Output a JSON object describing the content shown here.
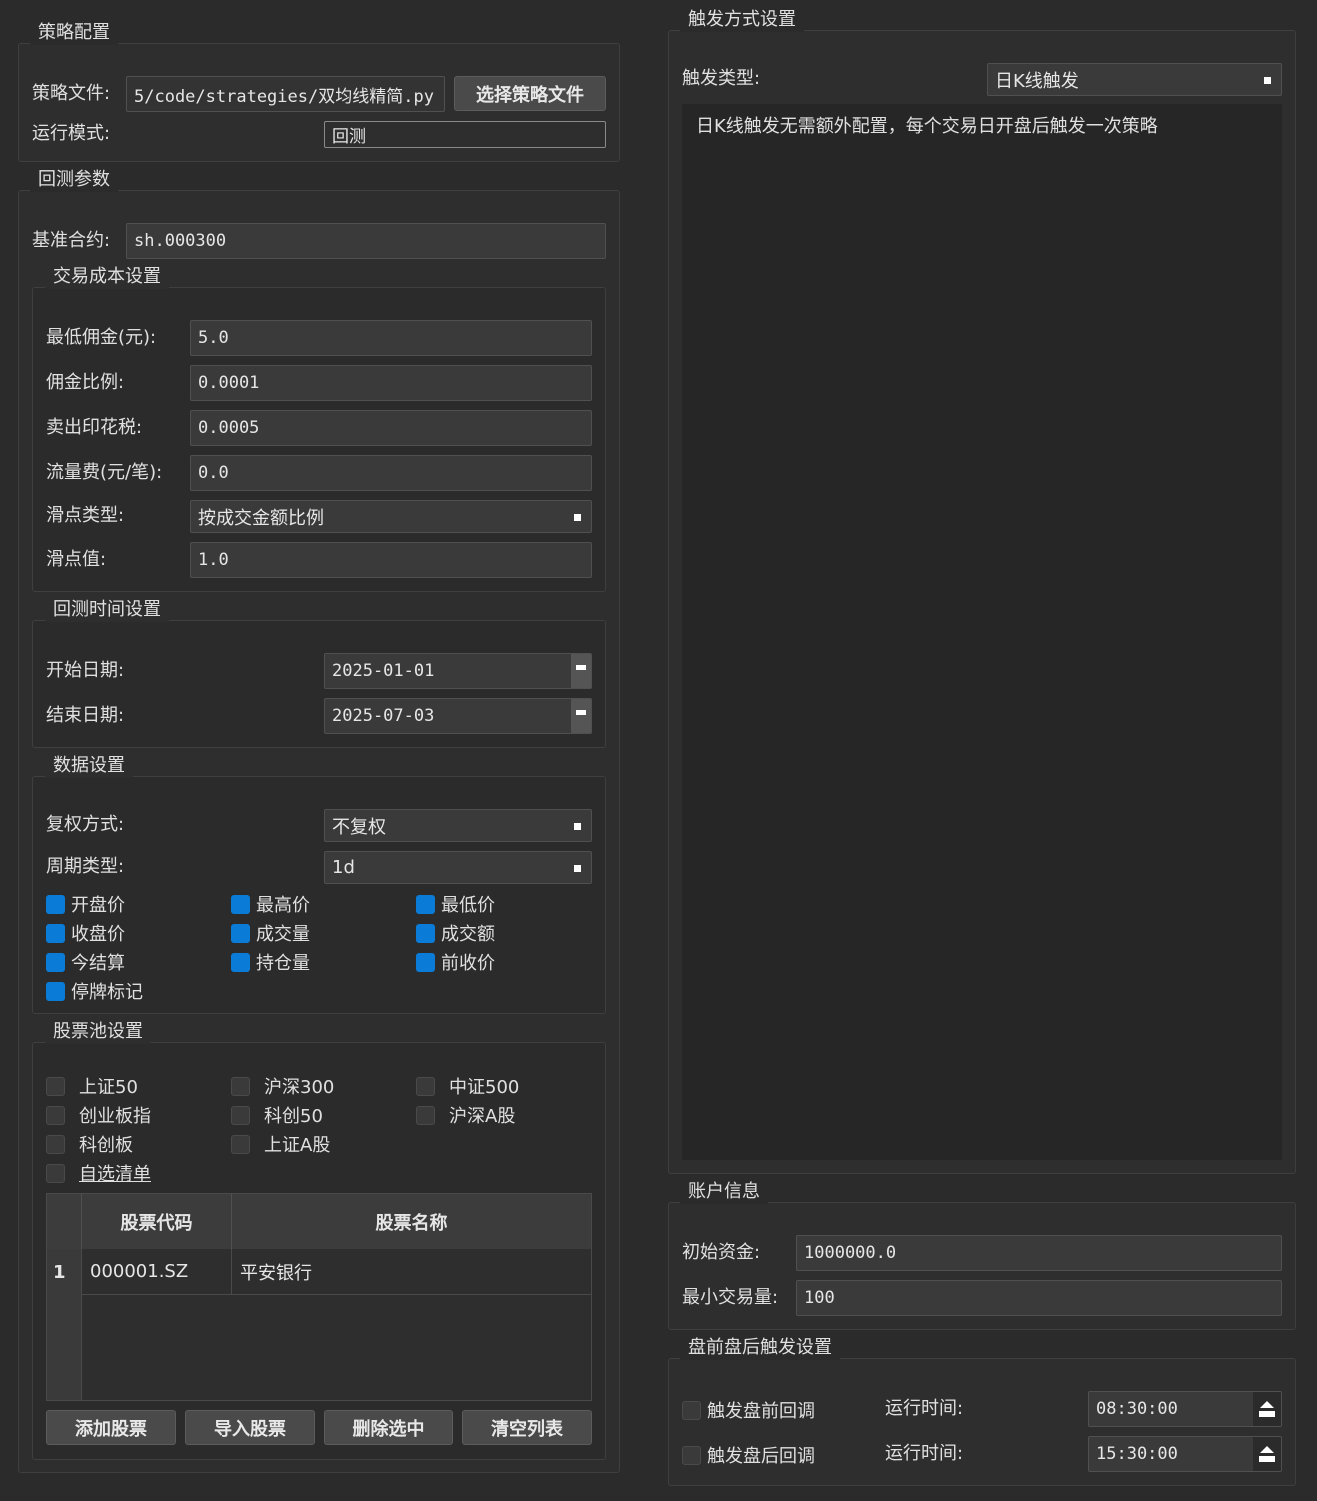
{
  "strategy": {
    "title": "策略配置",
    "file_label": "策略文件:",
    "file_value": "5/code/strategies/双均线精简.py",
    "choose_button": "选择策略文件",
    "mode_label": "运行模式:",
    "mode_value": "回测"
  },
  "backtest": {
    "title": "回测参数",
    "benchmark_label": "基准合约:",
    "benchmark_value": "sh.000300",
    "cost": {
      "title": "交易成本设置",
      "min_commission_label": "最低佣金(元):",
      "min_commission_value": "5.0",
      "commission_ratio_label": "佣金比例:",
      "commission_ratio_value": "0.0001",
      "stamp_tax_label": "卖出印花税:",
      "stamp_tax_value": "0.0005",
      "flow_fee_label": "流量费(元/笔):",
      "flow_fee_value": "0.0",
      "slippage_type_label": "滑点类型:",
      "slippage_type_value": "按成交金额比例",
      "slippage_value_label": "滑点值:",
      "slippage_value": "1.0"
    },
    "time": {
      "title": "回测时间设置",
      "start_label": "开始日期:",
      "start_value": "2025-01-01",
      "end_label": "结束日期:",
      "end_value": "2025-07-03"
    },
    "data": {
      "title": "数据设置",
      "adjust_label": "复权方式:",
      "adjust_value": "不复权",
      "period_label": "周期类型:",
      "period_value": "1d",
      "fields": [
        "开盘价",
        "最高价",
        "最低价",
        "收盘价",
        "成交量",
        "成交额",
        "今结算",
        "持仓量",
        "前收价",
        "停牌标记"
      ]
    },
    "pool": {
      "title": "股票池设置",
      "options": [
        "上证50",
        "沪深300",
        "中证500",
        "创业板指",
        "科创50",
        "沪深A股",
        "科创板",
        "上证A股"
      ],
      "custom_label": "自选清单",
      "table_headers": [
        "股票代码",
        "股票名称"
      ],
      "rows": [
        {
          "index": "1",
          "code": "000001.SZ",
          "name": "平安银行"
        }
      ],
      "buttons": [
        "添加股票",
        "导入股票",
        "删除选中",
        "清空列表"
      ]
    }
  },
  "trigger": {
    "title": "触发方式设置",
    "type_label": "触发类型:",
    "type_value": "日K线触发",
    "description": "日K线触发无需额外配置，每个交易日开盘后触发一次策略"
  },
  "account": {
    "title": "账户信息",
    "initial_capital_label": "初始资金:",
    "initial_capital_value": "1000000.0",
    "min_volume_label": "最小交易量:",
    "min_volume_value": "100"
  },
  "prepost": {
    "title": "盘前盘后触发设置",
    "pre_label": "触发盘前回调",
    "pre_time_label": "运行时间:",
    "pre_time_value": "08:30:00",
    "post_label": "触发盘后回调",
    "post_time_label": "运行时间:",
    "post_time_value": "15:30:00"
  }
}
